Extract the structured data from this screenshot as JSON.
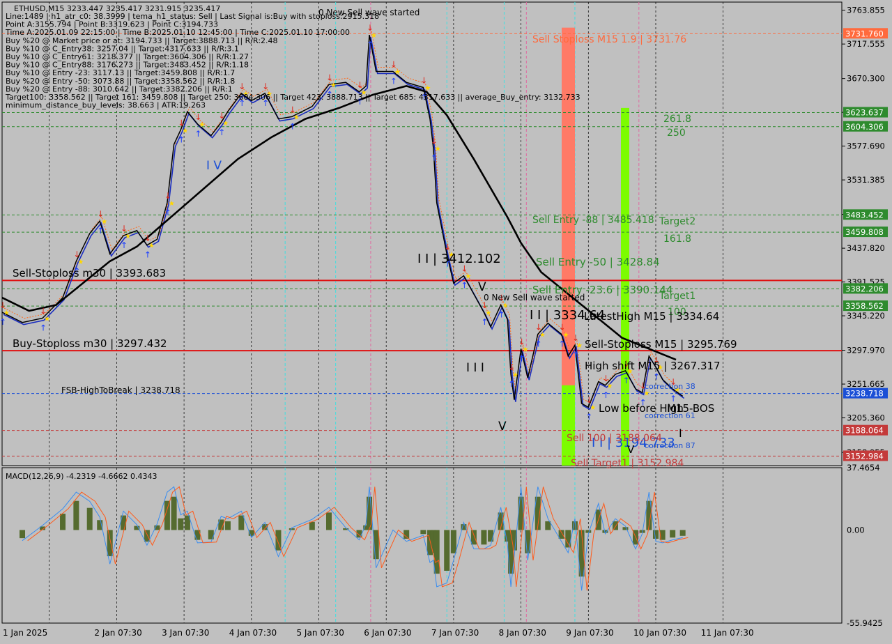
{
  "header": {
    "symbol_line": "ETHUSD,M15  3233.447 3235.417 3231.915 3235.417",
    "info_lines": [
      "Line:1489 | h1_atr_c0: 38.3999 | tema_h1_status: Sell | Last Signal is:Buy with stoploss:2915.318",
      "Point A:3155.794 | Point B:3319.623 | Point C:3194.733",
      "Time A:2025.01.09 22:15:00 | Time B:2025.01.10 12:45:00 | Time C:2025.01.10 17:00:00",
      "Buy %20 @ Market price or at: 3194.733 || Target:3888.713 || R/R:2.48",
      "Buy %10 @ C_Entry38: 3257.04 || Target:4317.633 || R/R:3.1",
      "Buy %10 @ C_Entry61: 3218.377 || Target:3604.306 || R/R:1.27",
      "Buy %10 @ C_Entry88: 3176.273 || Target:3483.452 || R/R:1.18",
      "Buy %10 @ Entry -23: 3117.13 || Target:3459.808 || R/R:1.7",
      "Buy %20 @ Entry -50: 3073.88 || Target:3358.562 || R/R:1.8",
      "Buy %20 @ Entry -88: 3010.642 || Target:3382.206 || R/R:1",
      "Target100: 3358.562 || Target 161: 3459.808 || Target 250: 3604.306 || Target 423: 3888.713 || Target 685: 4317.633 || average_Buy_entry: 3132.733",
      "minimum_distance_buy_levels: 38.663 | ATR:19.263"
    ],
    "top_notice": "0 New Sell wave started"
  },
  "chart_data": [
    {
      "type": "line",
      "title": "ETHUSD,M15",
      "x_ticks": [
        "1 Jan 2025",
        "2 Jan 07:30",
        "3 Jan 07:30",
        "4 Jan 07:30",
        "5 Jan 07:30",
        "6 Jan 07:30",
        "7 Jan 07:30",
        "8 Jan 07:30",
        "9 Jan 07:30",
        "10 Jan 07:30",
        "11 Jan 07:30"
      ],
      "y_ticks": [
        "3763.855",
        "3717.555",
        "3670.300",
        "3624.000",
        "3577.690",
        "3531.385",
        "3484.130",
        "3437.820",
        "3391.525",
        "3345.220",
        "3297.970",
        "3251.665",
        "3205.360",
        "3158.055"
      ],
      "ylim": [
        3140,
        3775
      ],
      "price_tags": [
        {
          "label": "3731.760",
          "value": 3731.76,
          "color": "#ff6a3d"
        },
        {
          "label": "3623.637",
          "value": 3623.637,
          "color": "#2e8b2e"
        },
        {
          "label": "3604.306",
          "value": 3604.306,
          "color": "#2e8b2e"
        },
        {
          "label": "3483.452",
          "value": 3483.452,
          "color": "#2e8b2e"
        },
        {
          "label": "3459.808",
          "value": 3459.808,
          "color": "#2e8b2e"
        },
        {
          "label": "3382.206",
          "value": 3382.206,
          "color": "#2e8b2e"
        },
        {
          "label": "3358.562",
          "value": 3358.562,
          "color": "#2e8b2e"
        },
        {
          "label": "3238.718",
          "value": 3238.718,
          "color": "#1a4fd6"
        },
        {
          "label": "3188.064",
          "value": 3188.064,
          "color": "#c43a3a"
        },
        {
          "label": "3152.984",
          "value": 3152.984,
          "color": "#c43a3a"
        }
      ],
      "series": [
        {
          "name": "price",
          "color": "#000000",
          "points": [
            [
              0,
              3350
            ],
            [
              0.3,
              3336
            ],
            [
              0.6,
              3342
            ],
            [
              0.9,
              3370
            ],
            [
              1.1,
              3420
            ],
            [
              1.3,
              3458
            ],
            [
              1.45,
              3475
            ],
            [
              1.6,
              3430
            ],
            [
              1.8,
              3455
            ],
            [
              2.0,
              3462
            ],
            [
              2.15,
              3442
            ],
            [
              2.3,
              3450
            ],
            [
              2.45,
              3500
            ],
            [
              2.55,
              3580
            ],
            [
              2.65,
              3600
            ],
            [
              2.75,
              3625
            ],
            [
              2.9,
              3608
            ],
            [
              3.1,
              3592
            ],
            [
              3.25,
              3610
            ],
            [
              3.35,
              3625
            ],
            [
              3.55,
              3650
            ],
            [
              3.7,
              3640
            ],
            [
              3.9,
              3650
            ],
            [
              4.1,
              3615
            ],
            [
              4.3,
              3618
            ],
            [
              4.6,
              3632
            ],
            [
              4.85,
              3662
            ],
            [
              5.1,
              3665
            ],
            [
              5.3,
              3652
            ],
            [
              5.4,
              3660
            ],
            [
              5.45,
              3730
            ],
            [
              5.55,
              3680
            ],
            [
              5.8,
              3680
            ],
            [
              6.0,
              3665
            ],
            [
              6.25,
              3658
            ],
            [
              6.35,
              3615
            ],
            [
              6.4,
              3575
            ],
            [
              6.45,
              3500
            ],
            [
              6.6,
              3430
            ],
            [
              6.7,
              3390
            ],
            [
              6.85,
              3400
            ],
            [
              7.0,
              3375
            ],
            [
              7.15,
              3350
            ],
            [
              7.25,
              3330
            ],
            [
              7.4,
              3360
            ],
            [
              7.5,
              3340
            ],
            [
              7.55,
              3265
            ],
            [
              7.6,
              3230
            ],
            [
              7.7,
              3300
            ],
            [
              7.8,
              3260
            ],
            [
              7.95,
              3320
            ],
            [
              8.1,
              3335
            ],
            [
              8.3,
              3320
            ],
            [
              8.4,
              3290
            ],
            [
              8.5,
              3305
            ],
            [
              8.6,
              3225
            ],
            [
              8.7,
              3220
            ],
            [
              8.85,
              3255
            ],
            [
              8.95,
              3250
            ],
            [
              9.1,
              3265
            ],
            [
              9.25,
              3270
            ],
            [
              9.4,
              3245
            ],
            [
              9.5,
              3240
            ],
            [
              9.6,
              3290
            ],
            [
              9.7,
              3275
            ],
            [
              9.8,
              3258
            ],
            [
              9.95,
              3245
            ],
            [
              10.1,
              3235
            ]
          ]
        },
        {
          "name": "ma",
          "color": "#000000",
          "points": [
            [
              0,
              3370
            ],
            [
              0.4,
              3352
            ],
            [
              0.8,
              3360
            ],
            [
              1.2,
              3390
            ],
            [
              1.6,
              3420
            ],
            [
              2.0,
              3440
            ],
            [
              2.5,
              3480
            ],
            [
              3.0,
              3520
            ],
            [
              3.5,
              3560
            ],
            [
              4.0,
              3590
            ],
            [
              4.5,
              3615
            ],
            [
              5.0,
              3630
            ],
            [
              5.5,
              3648
            ],
            [
              6.0,
              3660
            ],
            [
              6.3,
              3652
            ],
            [
              6.6,
              3620
            ],
            [
              7.0,
              3560
            ],
            [
              7.5,
              3480
            ],
            [
              7.7,
              3445
            ],
            [
              8.0,
              3405
            ],
            [
              8.4,
              3375
            ],
            [
              8.8,
              3345
            ],
            [
              9.2,
              3315
            ],
            [
              9.6,
              3300
            ],
            [
              10.0,
              3285
            ]
          ]
        }
      ]
    },
    {
      "type": "bar",
      "title": "MACD(12,26,9) -4.2319 -4.6662 0.4343",
      "y_ticks": [
        "37.4654",
        "0.00",
        "-55.9425"
      ],
      "ylim": [
        -55.9425,
        37.4654
      ]
    }
  ],
  "annotations": [
    {
      "text": "Sell Stoploss M15 1.9 | 3731.76",
      "color": "#ff6a3d"
    },
    {
      "text": "261.8",
      "color": "#2e8b2e"
    },
    {
      "text": "250",
      "color": "#2e8b2e"
    },
    {
      "text": "Sell Entry -88 | 3485.418",
      "color": "#2e8b2e"
    },
    {
      "text": "Target2",
      "color": "#2e8b2e"
    },
    {
      "text": "161.8",
      "color": "#2e8b2e"
    },
    {
      "text": "Sell Entry -50 | 3428.84",
      "color": "#2e8b2e"
    },
    {
      "text": "Sell Entry -23.6 | 3390.144",
      "color": "#2e8b2e"
    },
    {
      "text": "Target1",
      "color": "#2e8b2e"
    },
    {
      "text": "100",
      "color": "#2e8b2e"
    },
    {
      "text": "Sell-Stoploss m30 | 3393.683",
      "color": "#000000"
    },
    {
      "text": "Buy-Stoploss m30 | 3297.432",
      "color": "#000000"
    },
    {
      "text": "FSB-HighToBreak | 3238.718",
      "color": "#000000"
    },
    {
      "text": "I I | 3412.102",
      "color": "#000000"
    },
    {
      "text": "I V",
      "color": "#1a4fd6"
    },
    {
      "text": "V",
      "color": "#000000"
    },
    {
      "text": "0 New Sell wave started",
      "color": "#000000"
    },
    {
      "text": "I I I",
      "color": "#000000"
    },
    {
      "text": "V",
      "color": "#000000"
    },
    {
      "text": "I I | 3334.64",
      "color": "#000000"
    },
    {
      "text": "LatestHigh  M15 | 3334.64",
      "color": "#000000"
    },
    {
      "text": "Sell-Stoploss M15 | 3295.769",
      "color": "#000000"
    },
    {
      "text": "High shift  M15 | 3267.317",
      "color": "#000000"
    },
    {
      "text": "Low before High",
      "color": "#000000"
    },
    {
      "text": "M15-BOS",
      "color": "#000000"
    },
    {
      "text": "I I | 3194.733",
      "color": "#1a4fd6"
    },
    {
      "text": "Sell 100 | 3188.064",
      "color": "#c43a3a"
    },
    {
      "text": "Sell Target1 | 3152.984",
      "color": "#c43a3a"
    },
    {
      "text": "correction 38",
      "color": "#1a4fd6"
    },
    {
      "text": "correction 61",
      "color": "#1a4fd6"
    },
    {
      "text": "correction 87",
      "color": "#1a4fd6"
    },
    {
      "text": "I",
      "color": "#000000"
    },
    {
      "text": "V",
      "color": "#000000"
    }
  ]
}
